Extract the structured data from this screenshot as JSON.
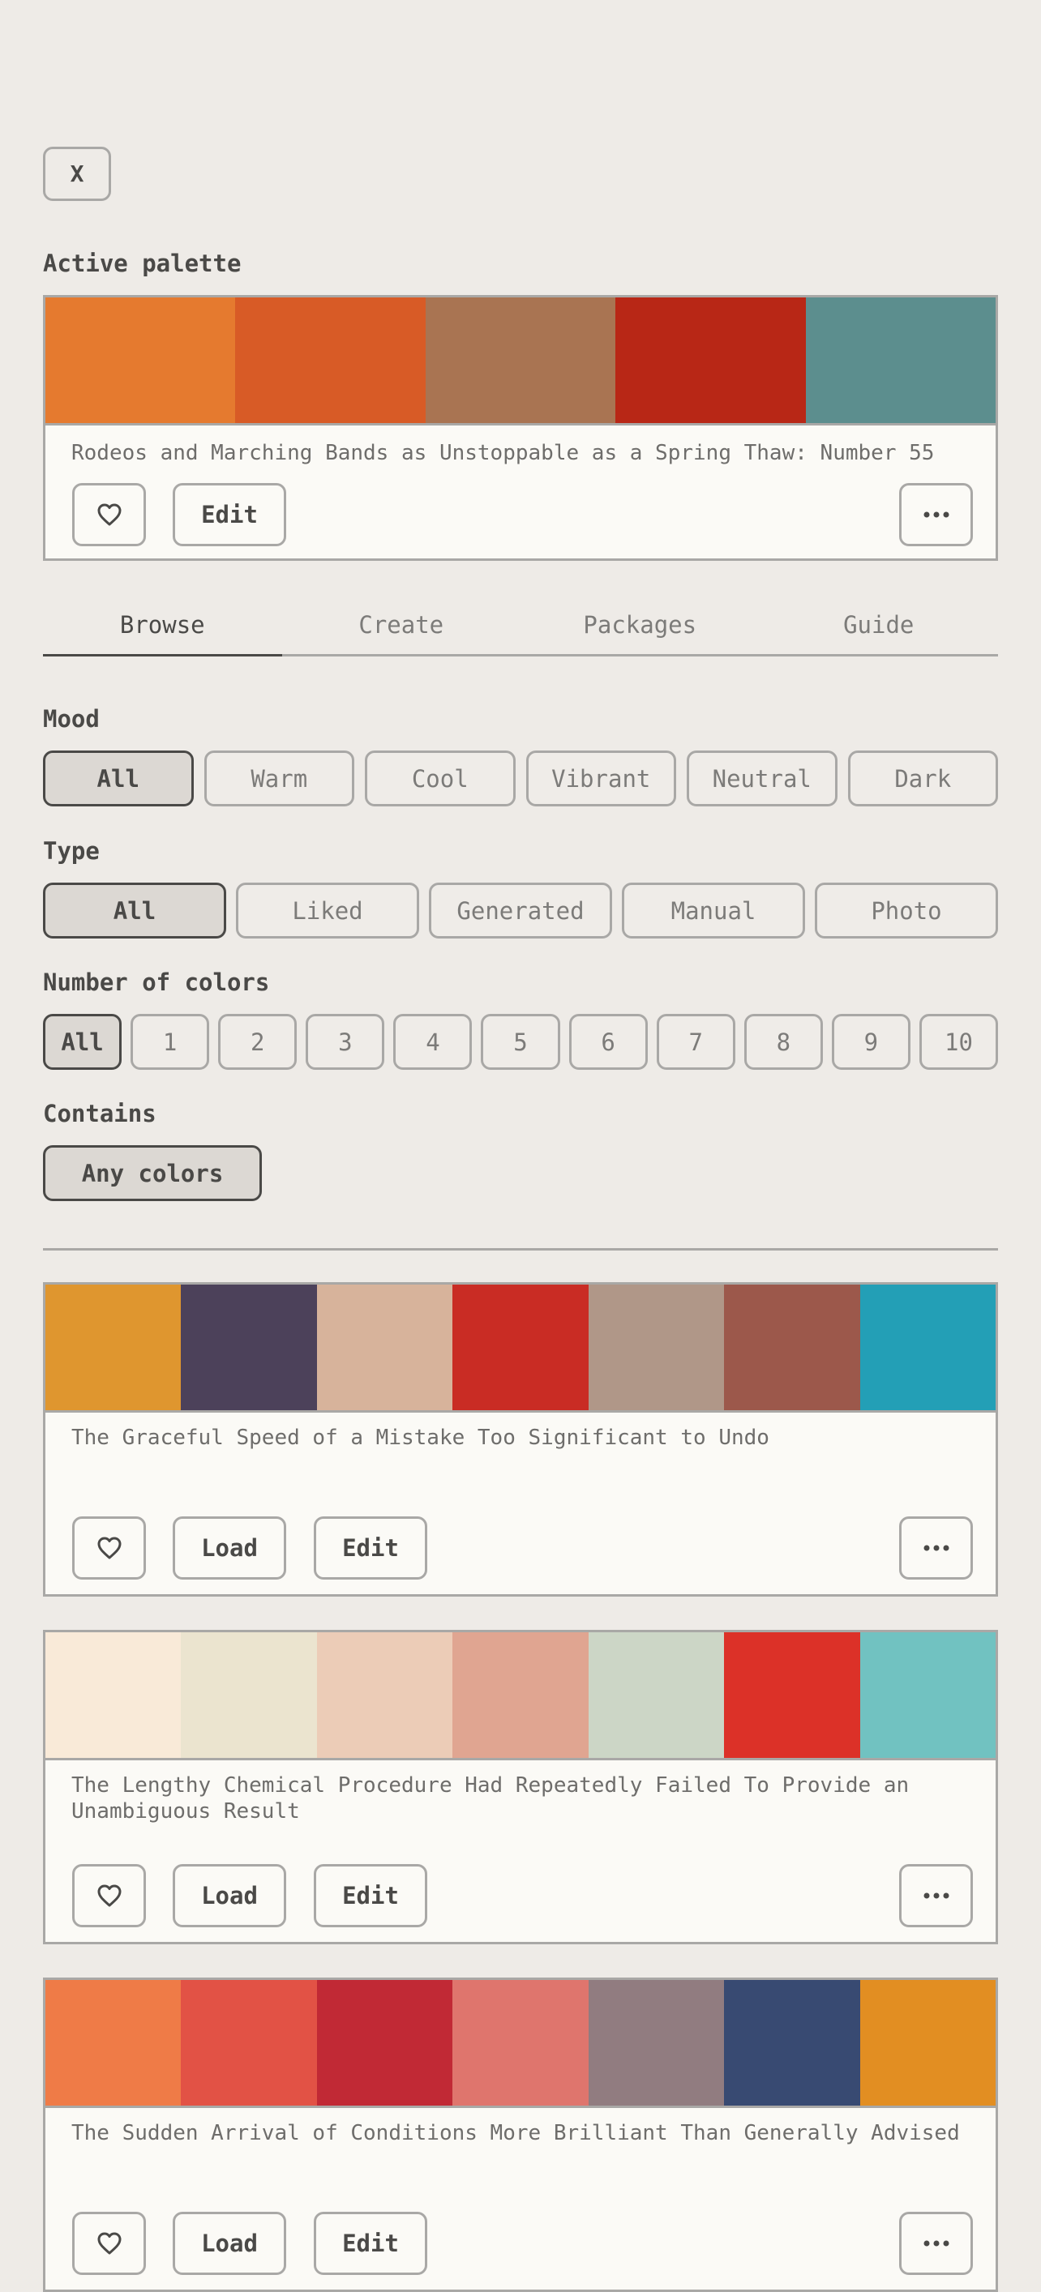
{
  "close_label": "X",
  "active_palette": {
    "heading": "Active palette",
    "colors": [
      "#e57a2f",
      "#d85b26",
      "#a97452",
      "#b82716",
      "#5c8e8e"
    ],
    "title": "Rodeos and Marching Bands as Unstoppable as a Spring Thaw: Number 55",
    "edit_label": "Edit",
    "like_icon": "heart-icon",
    "more_icon": "more-horizontal-icon"
  },
  "tabs": [
    {
      "label": "Browse",
      "active": true
    },
    {
      "label": "Create",
      "active": false
    },
    {
      "label": "Packages",
      "active": false
    },
    {
      "label": "Guide",
      "active": false
    }
  ],
  "filters": {
    "mood": {
      "label": "Mood",
      "options": [
        "All",
        "Warm",
        "Cool",
        "Vibrant",
        "Neutral",
        "Dark"
      ],
      "selected": "All"
    },
    "type": {
      "label": "Type",
      "options": [
        "All",
        "Liked",
        "Generated",
        "Manual",
        "Photo"
      ],
      "selected": "All"
    },
    "count": {
      "label": "Number of colors",
      "options": [
        "All",
        "1",
        "2",
        "3",
        "4",
        "5",
        "6",
        "7",
        "8",
        "9",
        "10"
      ],
      "selected": "All"
    },
    "contains": {
      "label": "Contains",
      "value": "Any colors"
    }
  },
  "palettes": [
    {
      "title": "The Graceful Speed of a Mistake Too Significant to Undo",
      "colors": [
        "#df962f",
        "#4c415a",
        "#d7b39b",
        "#c92c24",
        "#b09788",
        "#9c584b",
        "#239fb6"
      ],
      "load_label": "Load",
      "edit_label": "Edit"
    },
    {
      "title": "The Lengthy Chemical Procedure Had Repeatedly Failed To Provide an Unambiguous Result",
      "colors": [
        "#f9ead8",
        "#ebe4cf",
        "#ecccb7",
        "#e0a591",
        "#ccd6c6",
        "#dc3128",
        "#71c2c1"
      ],
      "load_label": "Load",
      "edit_label": "Edit"
    },
    {
      "title": "The Sudden Arrival of Conditions More Brilliant Than Generally Advised",
      "colors": [
        "#ef7b47",
        "#e25245",
        "#c12935",
        "#df756d",
        "#917c80",
        "#384a72",
        "#e28e22"
      ],
      "load_label": "Load",
      "edit_label": "Edit"
    }
  ]
}
